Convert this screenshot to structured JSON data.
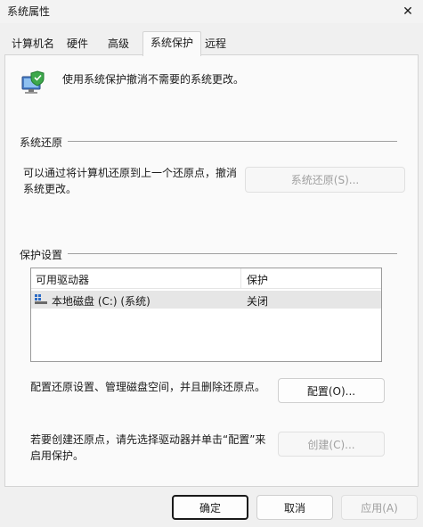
{
  "window": {
    "title": "系统属性",
    "close_glyph": "✕"
  },
  "tabs": [
    {
      "label": "计算机名",
      "active": false
    },
    {
      "label": "硬件",
      "active": false
    },
    {
      "label": "高级",
      "active": false
    },
    {
      "label": "系统保护",
      "active": true
    },
    {
      "label": "远程",
      "active": false
    }
  ],
  "header": {
    "icon": "system-protection-shield-icon",
    "description": "使用系统保护撤消不需要的系统更改。"
  },
  "restore_group": {
    "title": "系统还原",
    "text_line1": "可以通过将计算机还原到上一个还原点，撤消",
    "text_line2": "系统更改。",
    "button_label": "系统还原(S)..."
  },
  "protection_group": {
    "title": "保护设置",
    "columns": [
      "可用驱动器",
      "保护"
    ],
    "drives": [
      {
        "name": "本地磁盘 (C:) (系统)",
        "protection": "关闭",
        "icon": "drive-icon"
      }
    ],
    "configure_text": "配置还原设置、管理磁盘空间，并且删除还原点。",
    "configure_button": "配置(O)...",
    "create_text_line1": "若要创建还原点，请先选择驱动器并单击“配置”来",
    "create_text_line2": "启用保护。",
    "create_button": "创建(C)..."
  },
  "footer": {
    "ok": "确定",
    "cancel": "取消",
    "apply": "应用(A)"
  },
  "colors": {
    "window_bg": "#f0f0f0",
    "panel_bg": "#fafafa",
    "selected_row": "#e6e6e6",
    "disabled_text": "#a0a0a0",
    "shield_blue": "#2d6bc4"
  }
}
